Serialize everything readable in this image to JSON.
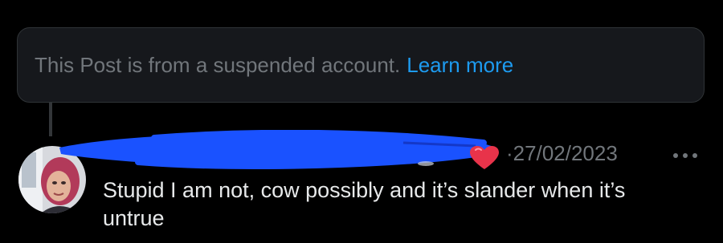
{
  "notice": {
    "text": "This Post is from a suspended account.",
    "link_label": "Learn more"
  },
  "reply": {
    "date_separator": "·",
    "date": "27/02/2023",
    "text": "Stupid I am not, cow possibly and it’s slander when it’s untrue"
  },
  "icons": {
    "avatar": "user-avatar-photo",
    "heart": "heart-emoji-icon",
    "more": "more-options-icon",
    "redaction": "blue-marker-scribble"
  },
  "colors": {
    "background": "#000000",
    "notice_background": "#16181c",
    "secondary_text": "#71767b",
    "link": "#1d9bf0",
    "primary_text": "#e7e9ea",
    "redaction": "#1a52ff",
    "heart": "#e8334a"
  }
}
